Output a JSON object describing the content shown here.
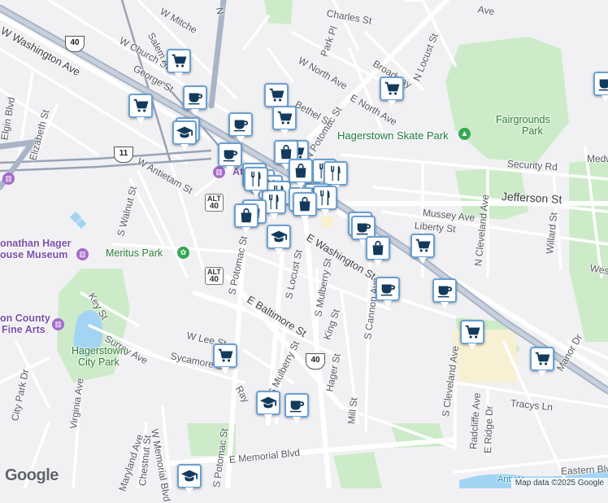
{
  "colors": {
    "background": "#f1f1f4",
    "park": "#cdebc9",
    "water": "#a3d4f3",
    "rail": "#9aa3b5",
    "highway": "#a9b4c8",
    "pin_border": "#6aa0d4",
    "pin_icon": "#123a5c",
    "poi": "#7b4ea8",
    "park_label": "#2e7d32"
  },
  "streets": {
    "w_washington_ave": "W Washington Ave",
    "w_church_st": "W Church St",
    "george_st": "George St",
    "mitchell_ave": "W Mitche",
    "salem_ave": "Salem A",
    "w_antietam_st": "W Antietam St",
    "s_walnut_st": "S Walnut St",
    "s_potomac_st_top": "S Potomac St",
    "s_potomac_st_bottom": "S Potomac St",
    "s_locust_st": "S Locust St",
    "s_mulberry_st": "S Mulberry St",
    "s_mulberry_st_2": "S Mulberry St",
    "e_washington_st": "E Washington St",
    "e_baltimore_st": "E Baltimore St",
    "w_lee_st": "W Lee St",
    "sycamore_st": "Sycamore St",
    "surrey_ave": "Surrey Ave",
    "key_st": "Key St",
    "virginia_ave": "Virginia Ave",
    "city_park_dr": "City Park Dr",
    "chestnut_st": "Chestnut St",
    "w_memorial_blvd": "W Memorial Blvd",
    "e_memorial_blvd": "E Memorial Blvd",
    "maryland_ave": "Maryland Ave",
    "elgin_blvd": "Elgin Blvd",
    "elizabeth_st": "Elizabeth St",
    "charles_st": "Charles St",
    "park_pl": "Park Pl",
    "w_north_ave": "W North Ave",
    "e_north_ave": "E North Ave",
    "broadway": "Broadway",
    "n_locust_st": "N Locust St",
    "n_potomac_st": "N Potomac St",
    "bethel_st": "Bethel St",
    "mussey_ave": "Mussey Ave",
    "jefferson_st": "Jefferson St",
    "liberty_st": "Liberty St",
    "n_cleveland_ave": "N Cleveland Ave",
    "willard_st": "Willard St",
    "security_rd": "Security Rd",
    "medway": "Medw",
    "westfield": "Westf",
    "s_cannon_ave": "S Cannon Ave",
    "king_st": "King St",
    "hager_st": "Hager St",
    "mill_st": "Mill St",
    "s_cleveland_ave": "S Cleveland Ave",
    "radcliffe_ave": "Radcliffe Ave",
    "e_ridge_dr": "E Ridge Dr",
    "tracys_ln": "Tracys Ln",
    "manor_dr": "Manor Dr",
    "eastern_blvd": "Eastern Blvd",
    "ray_st": "Ray",
    "n_alley": "N",
    "ave_top": "Ave",
    "s_maryland_ave": "Maryland Ave"
  },
  "places": {
    "hagerstown_skate_park": "Hagerstown Skate Park",
    "fairgrounds_park_line1": "Fairgrounds",
    "fairgrounds_park_line2": "Park",
    "meritus_park": "Meritus Park",
    "jonathan_hager_line1": "onathan Hager",
    "jonathan_hager_line2": "ouse Museum",
    "county_arts_line1": "on County",
    "county_arts_line2": "Fine Arts",
    "hagerstown_city_park_line1": "Hagerstown",
    "hagerstown_city_park_line2": "City Park",
    "antietam_creek": "Antieta",
    "downtown_partial": "Ati",
    "downtown_partial_2": "In"
  },
  "route_shields": {
    "us40_top": "40",
    "us11": "11",
    "alt40_a_top": "ALT",
    "alt40_a_num": "40",
    "alt40_b_top": "ALT",
    "alt40_b_num": "40",
    "us40_bottom": "40"
  },
  "markers": [
    {
      "icon": "shopping-cart-icon",
      "kind": "grocery"
    },
    {
      "icon": "coffee-cup-icon",
      "kind": "cafe"
    },
    {
      "icon": "shopping-cart-icon",
      "kind": "grocery"
    },
    {
      "icon": "shopping-cart-icon",
      "kind": "grocery"
    },
    {
      "icon": "graduation-cap-icon",
      "kind": "school"
    },
    {
      "icon": "coffee-cup-icon",
      "kind": "cafe"
    },
    {
      "icon": "shopping-cart-icon",
      "kind": "grocery"
    },
    {
      "icon": "shopping-cart-icon",
      "kind": "grocery"
    },
    {
      "icon": "coffee-cup-icon",
      "kind": "cafe"
    },
    {
      "icon": "shopping-bag-icon",
      "kind": "shopping"
    },
    {
      "icon": "fork-knife-icon",
      "kind": "restaurant"
    },
    {
      "icon": "shopping-bag-icon",
      "kind": "shopping"
    },
    {
      "icon": "graduation-cap-icon",
      "kind": "school"
    },
    {
      "icon": "coffee-cup-icon",
      "kind": "cafe"
    },
    {
      "icon": "shopping-bag-icon",
      "kind": "shopping"
    },
    {
      "icon": "shopping-cart-icon",
      "kind": "grocery"
    },
    {
      "icon": "coffee-cup-icon",
      "kind": "cafe"
    },
    {
      "icon": "coffee-cup-icon",
      "kind": "cafe"
    },
    {
      "icon": "shopping-cart-icon",
      "kind": "grocery"
    },
    {
      "icon": "shopping-cart-icon",
      "kind": "grocery"
    },
    {
      "icon": "shopping-cart-icon",
      "kind": "grocery"
    },
    {
      "icon": "graduation-cap-icon",
      "kind": "school"
    },
    {
      "icon": "coffee-cup-icon",
      "kind": "cafe"
    },
    {
      "icon": "graduation-cap-icon",
      "kind": "school"
    },
    {
      "icon": "shopping-cart-icon",
      "kind": "grocery"
    },
    {
      "icon": "coffee-cup-icon",
      "kind": "cafe"
    }
  ],
  "footer": {
    "logo": "Google",
    "attribution": "Map data ©2025 Google"
  }
}
